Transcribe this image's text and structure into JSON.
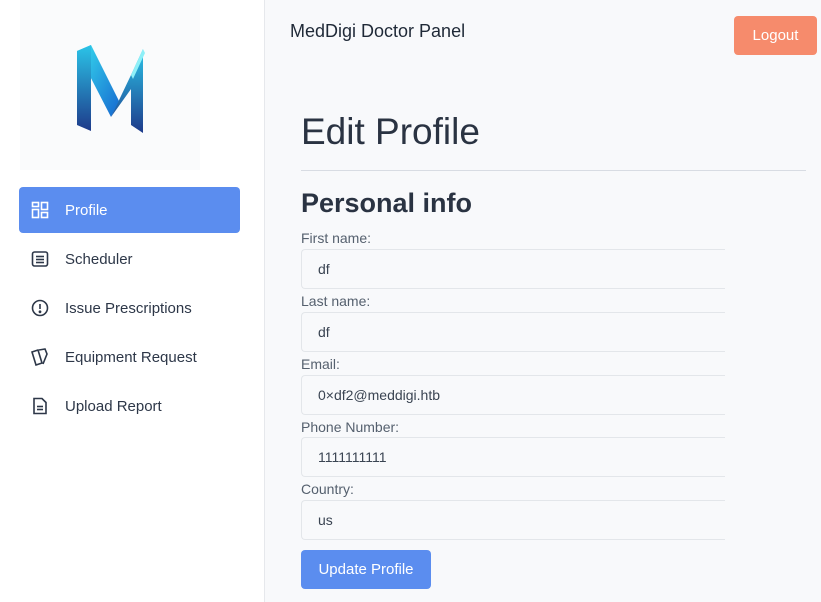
{
  "header": {
    "title": "MedDigi Doctor Panel",
    "logout_label": "Logout"
  },
  "logo": {
    "letter": "M",
    "colors": [
      "#2bd4e8",
      "#1a73d6",
      "#1e3a8a"
    ]
  },
  "sidebar": {
    "items": [
      {
        "label": "Profile",
        "icon": "grid-icon",
        "active": true
      },
      {
        "label": "Scheduler",
        "icon": "list-icon",
        "active": false
      },
      {
        "label": "Issue Prescriptions",
        "icon": "alert-circle-icon",
        "active": false
      },
      {
        "label": "Equipment Request",
        "icon": "cards-icon",
        "active": false
      },
      {
        "label": "Upload Report",
        "icon": "file-icon",
        "active": false
      }
    ]
  },
  "main": {
    "page_title": "Edit Profile",
    "section_title": "Personal info",
    "fields": [
      {
        "label": "First name:",
        "value": "df"
      },
      {
        "label": "Last name:",
        "value": "df"
      },
      {
        "label": "Email:",
        "value": "0×df2@meddigi.htb"
      },
      {
        "label": "Phone Number:",
        "value": "1111111111"
      },
      {
        "label": "Country:",
        "value": "us"
      }
    ],
    "submit_label": "Update Profile"
  },
  "colors": {
    "accent": "#5b8def",
    "logout": "#f68b6c"
  }
}
